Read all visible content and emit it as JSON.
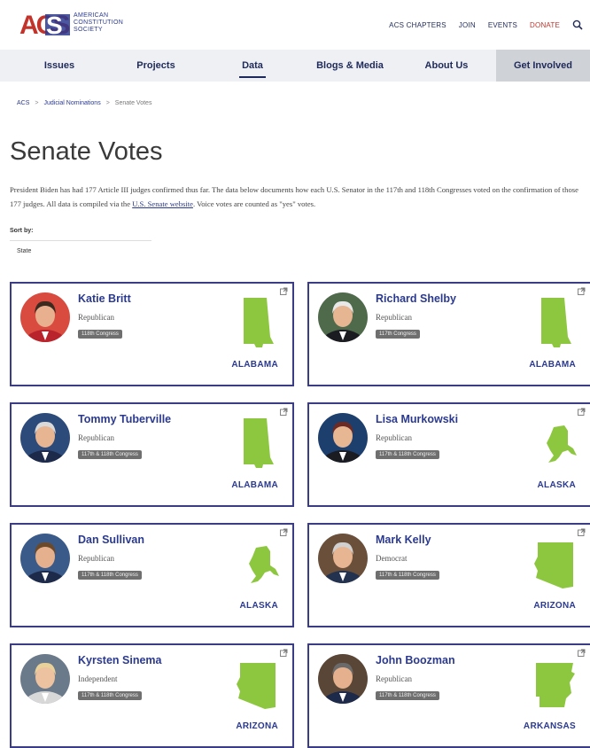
{
  "logo": {
    "mark_text": "ACS",
    "line1": "AMERICAN",
    "line2": "CONSTITUTION",
    "line3": "SOCIETY"
  },
  "topnav": {
    "chapters": "ACS CHAPTERS",
    "join": "JOIN",
    "events": "EVENTS",
    "donate": "DONATE",
    "search_icon": "search-icon"
  },
  "mainnav": {
    "items": [
      "Issues",
      "Projects",
      "Data",
      "Blogs & Media",
      "About Us"
    ],
    "active": "Data",
    "cta": "Get Involved"
  },
  "breadcrumb": [
    "ACS",
    "Judicial Nominations",
    "Senate Votes"
  ],
  "page": {
    "title": "Senate Votes",
    "desc_part1": "President Biden has had 177 Article III judges confirmed thus far. The data below documents how each U.S. Senator in the 117th and 118th Congresses voted on the confirmation of those 177 judges. All data is compiled via the ",
    "desc_link": "U.S. Senate website",
    "desc_part2": ". Voice votes are counted as \"yes\" votes.",
    "sort_label": "Sort by:",
    "sort_value": "State"
  },
  "cards": [
    {
      "name": "Katie Britt",
      "party": "Republican",
      "congress": "118th Congress",
      "state": "ALABAMA"
    },
    {
      "name": "Richard Shelby",
      "party": "Republican",
      "congress": "117th Congress",
      "state": "ALABAMA"
    },
    {
      "name": "Tommy Tuberville",
      "party": "Republican",
      "congress": "117th & 118th Congress",
      "state": "ALABAMA"
    },
    {
      "name": "Lisa Murkowski",
      "party": "Republican",
      "congress": "117th & 118th Congress",
      "state": "ALASKA"
    },
    {
      "name": "Dan Sullivan",
      "party": "Republican",
      "congress": "117th & 118th Congress",
      "state": "ALASKA"
    },
    {
      "name": "Mark Kelly",
      "party": "Democrat",
      "congress": "117th & 118th Congress",
      "state": "ARIZONA"
    },
    {
      "name": "Kyrsten Sinema",
      "party": "Independent",
      "congress": "117th & 118th Congress",
      "state": "ARIZONA"
    },
    {
      "name": "John Boozman",
      "party": "Republican",
      "congress": "117th & 118th Congress",
      "state": "ARKANSAS"
    }
  ],
  "colors": {
    "brand_navy": "#1f2a5c",
    "card_border": "#3a3d86",
    "state_green": "#8dc63f",
    "donate_red": "#c2342b",
    "badge_gray": "#6f6f6f"
  }
}
